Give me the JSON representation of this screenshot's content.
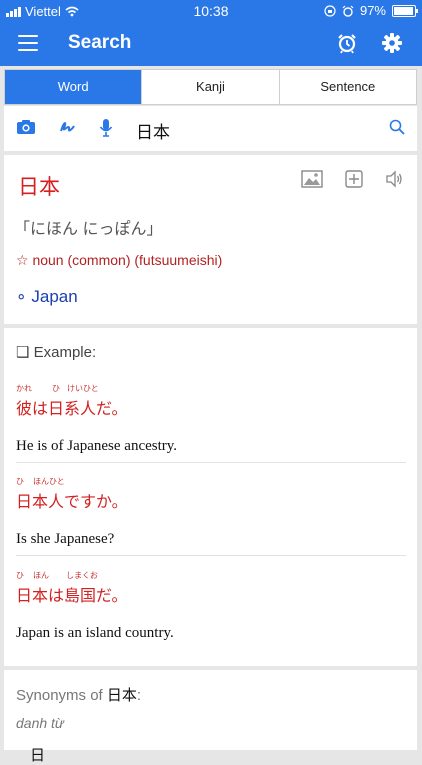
{
  "status": {
    "carrier": "Viettel",
    "time": "10:38",
    "battery": "97%",
    "battery_level": 0.97
  },
  "nav": {
    "title": "Search"
  },
  "tabs": [
    {
      "label": "Word",
      "active": true
    },
    {
      "label": "Kanji",
      "active": false
    },
    {
      "label": "Sentence",
      "active": false
    }
  ],
  "search": {
    "query": "日本"
  },
  "entry": {
    "word": "日本",
    "reading": "「にほん にっぽん」",
    "part_of_speech": "☆ noun (common) (futsuumeishi)",
    "meaning": "∘ Japan"
  },
  "examples": {
    "heading": "❑ Example:",
    "items": [
      {
        "furigana": [
          "かれ",
          "ひ",
          "けいひと"
        ],
        "japanese": "彼は日系人だ。",
        "english": "He is of Japanese ancestry."
      },
      {
        "furigana": [
          "ひ",
          "ほんひと"
        ],
        "japanese": "日本人ですか。",
        "english": "Is she Japanese?"
      },
      {
        "furigana": [
          "ひ",
          "ほん",
          "しまくお"
        ],
        "japanese": "日本は島国だ。",
        "english": "Japan is an island country."
      }
    ]
  },
  "synonyms": {
    "prefix": "Synonyms of ",
    "keyword": "日本",
    "suffix": ":",
    "type": "danh từ",
    "peek": "日"
  },
  "colors": {
    "primary": "#2a78e8",
    "red": "#d42020",
    "meaning_blue": "#1a3fb0"
  }
}
